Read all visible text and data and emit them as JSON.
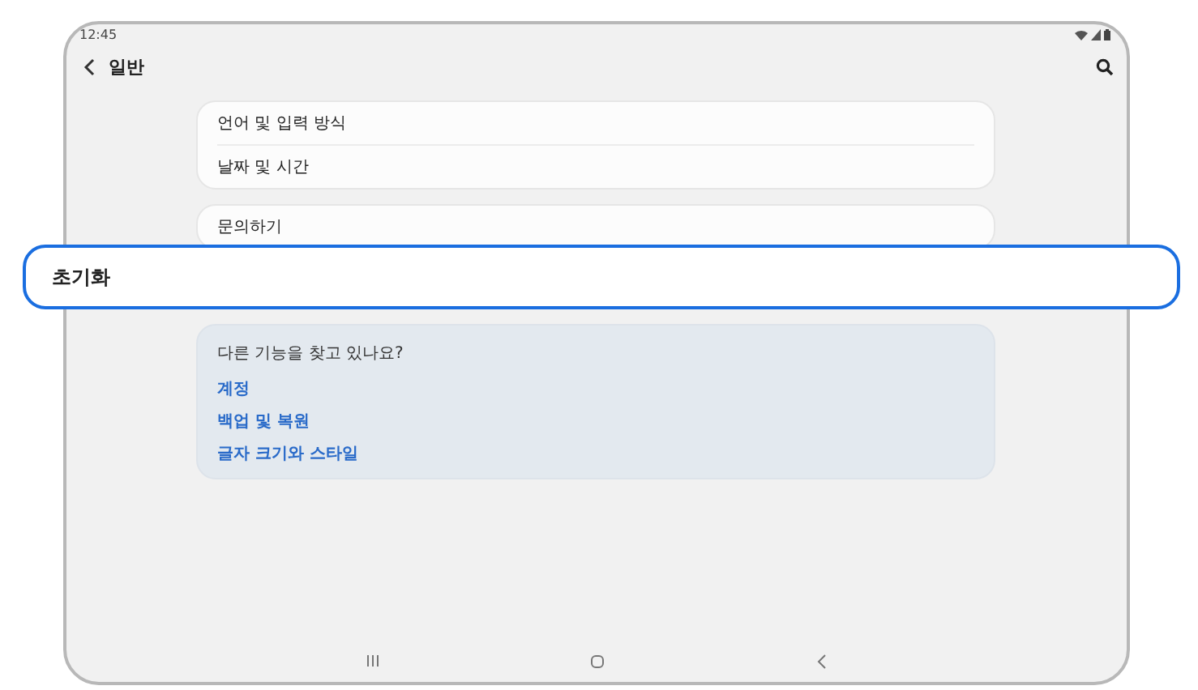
{
  "status_bar": {
    "time": "12:45"
  },
  "header": {
    "title": "일반"
  },
  "groups": [
    {
      "items": [
        "언어 및 입력 방식",
        "날짜 및 시간"
      ]
    },
    {
      "items": [
        "문의하기"
      ]
    }
  ],
  "highlight": {
    "label": "초기화"
  },
  "suggestions": {
    "title": "다른 기능을 찾고 있나요?",
    "links": [
      "계정",
      "백업 및 복원",
      "글자 크기와 스타일"
    ]
  }
}
